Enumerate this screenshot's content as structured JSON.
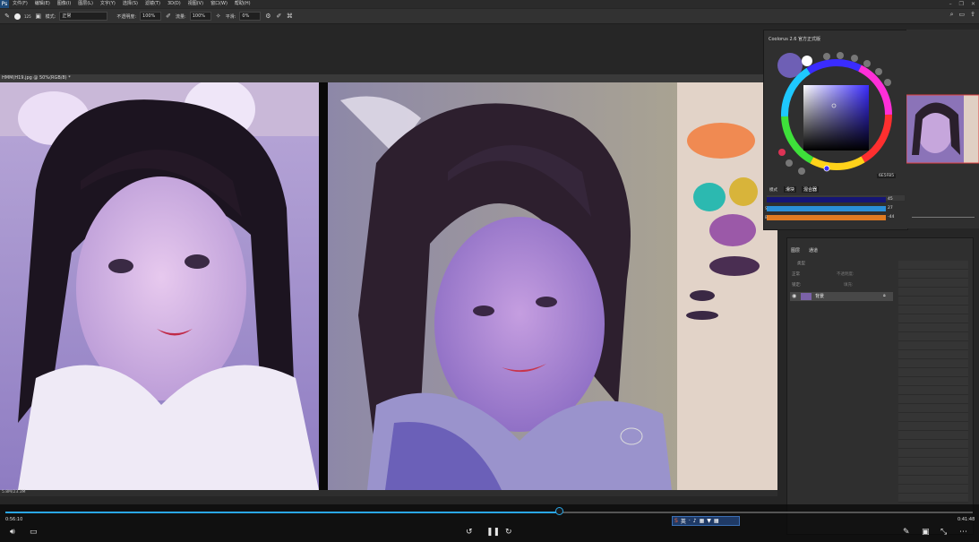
{
  "menu": {
    "app_logo": "Ps",
    "items": [
      "文件(F)",
      "编辑(E)",
      "图像(I)",
      "图层(L)",
      "文字(Y)",
      "选择(S)",
      "滤镜(T)",
      "3D(D)",
      "视图(V)",
      "窗口(W)",
      "帮助(H)"
    ]
  },
  "options": {
    "brush_size": "125",
    "mode_label": "模式:",
    "mode_value": "正常",
    "opacity_label": "不透明度:",
    "opacity_value": "100%",
    "flow_label": "流量:",
    "flow_value": "100%",
    "smooth_label": "平滑:",
    "smooth_value": "0%"
  },
  "document": {
    "tab_title": "HMM(H19.jpg @ 50%(RGB/8) *",
    "status": "5.8M/23.3M"
  },
  "color_panel": {
    "title": "Coolorus 2.6 官方正式版",
    "hex": "6E5FB5",
    "mode_label": "模式",
    "tab1": "滑块",
    "tab2": "混合器",
    "sliders": [
      {
        "label": "",
        "value": "45"
      },
      {
        "label": "S",
        "value": "27"
      },
      {
        "label": "B",
        "value": "-44"
      }
    ],
    "accent_color": "#6E5FB5"
  },
  "layers_panel": {
    "tab_layers": "图层",
    "tab_channels": "通道",
    "kind_label": "类型",
    "blend_mode": "正常",
    "opacity_label": "不透明度:",
    "lock_label": "锁定:",
    "fill_label": "填充:",
    "layer_name": "背景"
  },
  "video": {
    "current_time": "0:56:10",
    "total_time": "0:41:48",
    "progress": 0.572,
    "ime_label": "英"
  }
}
